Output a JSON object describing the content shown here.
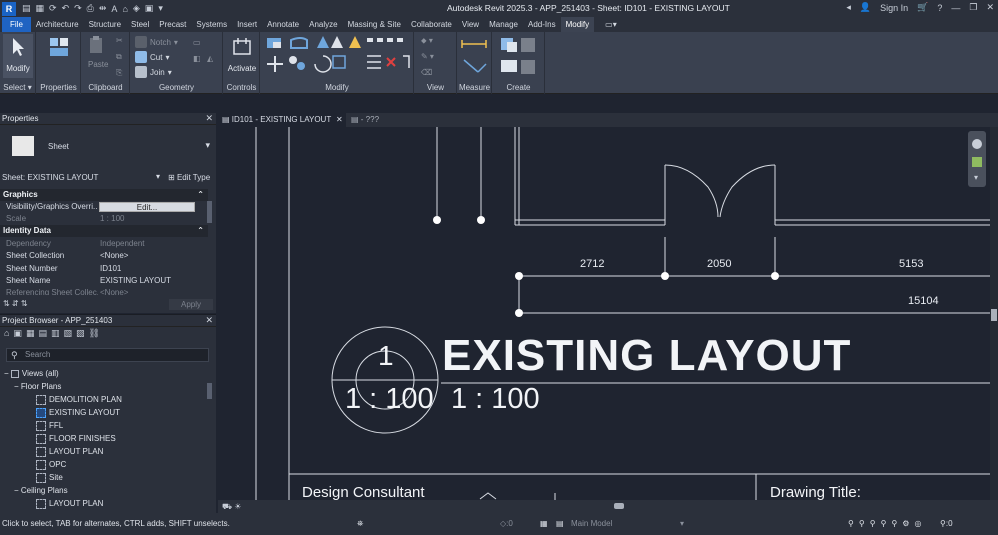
{
  "app": {
    "title": "Autodesk Revit 2025.3 - APP_251403 - Sheet: ID101 - EXISTING LAYOUT",
    "logo": "R",
    "sign_in": "Sign In"
  },
  "tabs": [
    "File",
    "Architecture",
    "Structure",
    "Steel",
    "Precast",
    "Systems",
    "Insert",
    "Annotate",
    "Analyze",
    "Massing & Site",
    "Collaborate",
    "View",
    "Manage",
    "Add-Ins",
    "Modify"
  ],
  "active_tab": "Modify",
  "ribbon": {
    "select": {
      "label": "Select",
      "button": "Modify"
    },
    "properties": {
      "label": "Properties"
    },
    "clipboard": {
      "label": "Clipboard",
      "paste": "Paste"
    },
    "geometry": {
      "label": "Geometry",
      "notch": "Notch",
      "cut": "Cut",
      "join": "Join"
    },
    "controls": {
      "label": "Controls",
      "activate": "Activate"
    },
    "modify": {
      "label": "Modify"
    },
    "view": {
      "label": "View"
    },
    "measure": {
      "label": "Measure"
    },
    "create": {
      "label": "Create"
    }
  },
  "properties": {
    "title": "Properties",
    "type_name": "Sheet",
    "selector": "Sheet: EXISTING LAYOUT",
    "edit_type": "Edit Type",
    "groups": {
      "graphics": "Graphics",
      "identity": "Identity Data"
    },
    "rows": {
      "vis_key": "Visibility/Graphics Overri...",
      "vis_val": "Edit...",
      "scale_key": "Scale",
      "scale_val": "1 : 100",
      "dep_key": "Dependency",
      "dep_val": "Independent",
      "coll_key": "Sheet Collection",
      "coll_val": "<None>",
      "num_key": "Sheet Number",
      "num_val": "ID101",
      "name_key": "Sheet Name",
      "name_val": "EXISTING LAYOUT",
      "ref_key": "Referencing Sheet Collec...",
      "ref_val": "<None>"
    },
    "apply": "Apply"
  },
  "project_browser": {
    "title": "Project Browser - APP_251403",
    "search_placeholder": "Search",
    "views_all": "Views (all)",
    "floor_plans": "Floor Plans",
    "floor_items": [
      "DEMOLITION PLAN",
      "EXISTING LAYOUT",
      "FFL",
      "FLOOR FINISHES",
      "LAYOUT PLAN",
      "OPC",
      "Site"
    ],
    "ceiling_plans": "Ceiling Plans",
    "ceiling_items": [
      "LAYOUT PLAN"
    ]
  },
  "view_tabs": {
    "active": "ID101 - EXISTING LAYOUT",
    "second": "- ???"
  },
  "drawing": {
    "dims": [
      "2712",
      "2050",
      "5153",
      "15104"
    ],
    "view_number": "1",
    "view_title": "EXISTING LAYOUT",
    "scale_in_tag": "1 : 100",
    "scale_text": "1 : 100",
    "design_consultant": "Design Consultant",
    "drawing_title": "Drawing Title:"
  },
  "status": {
    "message": "Click to select, TAB for alternates, CTRL adds, SHIFT unselects.",
    "workset_count": ":0",
    "model": "Main Model",
    "filter_count": ":0"
  },
  "colors": {
    "accent": "#1f63c2",
    "ribbon": "#3a4150",
    "canvas": "#1f2430"
  }
}
